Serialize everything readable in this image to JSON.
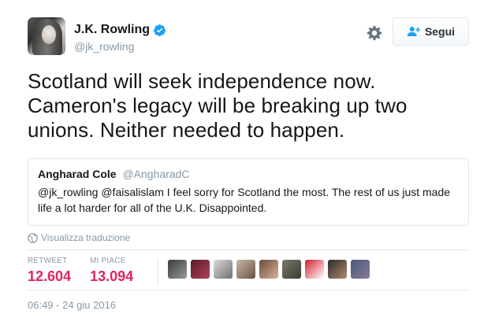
{
  "user": {
    "display_name": "J.K. Rowling",
    "handle": "@jk_rowling",
    "verified": true,
    "avatar_icon": "avatar-photo"
  },
  "actions": {
    "settings_icon": "gear-icon",
    "follow_label": "Segui",
    "follow_icon": "add-user-icon"
  },
  "tweet": {
    "text": "Scotland will seek independence now. Cameron's legacy will be breaking up two unions. Neither needed to happen."
  },
  "quoted_tweet": {
    "name": "Angharad Cole",
    "handle": "@AngharadC",
    "text": "@jk_rowling @faisalislam I feel sorry for Scotland  the most. The rest of us just made life a lot harder for all of the U.K. Disappointed."
  },
  "translate": {
    "label": "Visualizza traduzione",
    "icon": "globe-icon"
  },
  "stats": {
    "retweet_label": "RETWEET",
    "retweet_count": "12.604",
    "likes_label": "MI PIACE",
    "likes_count": "13.094"
  },
  "likers": [
    {
      "name": "liker-avatar-1",
      "colors": [
        "#3b3b3b",
        "#9a9a9a"
      ]
    },
    {
      "name": "liker-avatar-2",
      "colors": [
        "#5a1c2a",
        "#b0405a"
      ]
    },
    {
      "name": "liker-avatar-3",
      "colors": [
        "#dcdcdc",
        "#707070"
      ]
    },
    {
      "name": "liker-avatar-4",
      "colors": [
        "#c9b8a8",
        "#6a5240"
      ]
    },
    {
      "name": "liker-avatar-5",
      "colors": [
        "#6b4a3a",
        "#d9b39a"
      ]
    },
    {
      "name": "liker-avatar-6",
      "colors": [
        "#7a7a6a",
        "#3a3a30"
      ]
    },
    {
      "name": "liker-avatar-7",
      "colors": [
        "#d0212d",
        "#ffffff"
      ]
    },
    {
      "name": "liker-avatar-8",
      "colors": [
        "#2a2a2a",
        "#b08a6a"
      ]
    },
    {
      "name": "liker-avatar-9",
      "colors": [
        "#4a5a7a",
        "#8a7a9a"
      ]
    }
  ],
  "timestamp": "06:49 - 24 giu 2016",
  "colors": {
    "accent": "#1da1f2",
    "like_red": "#e0245e",
    "muted": "#8899a6",
    "border": "#e1e8ed"
  }
}
